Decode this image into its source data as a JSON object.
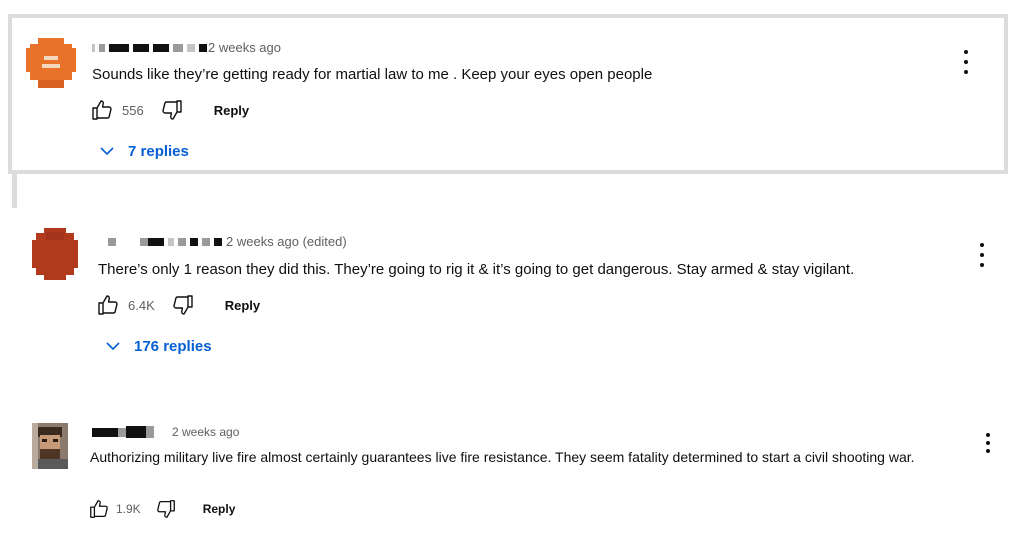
{
  "comments": [
    {
      "timestamp": "2 weeks ago",
      "text": "Sounds like they’re getting ready for martial law to me . Keep your eyes open people",
      "likes": "556",
      "reply_label": "Reply",
      "replies_label": "7 replies",
      "avatar_color": "#e8722a",
      "highlighted": true
    },
    {
      "timestamp": "2 weeks ago (edited)",
      "text": "There’s only 1 reason they did this. They’re going to rig it & it’s going to get dangerous. Stay armed & stay vigilant.",
      "likes": "6.4K",
      "reply_label": "Reply",
      "replies_label": "176 replies",
      "avatar_color": "#b23a1c"
    },
    {
      "timestamp": "2 weeks ago",
      "text": "Authorizing military live fire almost certainly guarantees live fire resistance. They seem fatality determined to start a civil shooting war.",
      "likes": "1.9K",
      "reply_label": "Reply",
      "avatar_color": "#6b4a35"
    }
  ],
  "colors": {
    "link_blue": "#065fd4",
    "highlight_border": "#dcdcdc",
    "secondary_text": "#606060"
  },
  "icons": [
    "thumbs-up-icon",
    "thumbs-down-icon",
    "chevron-down-icon",
    "more-vert-icon"
  ]
}
